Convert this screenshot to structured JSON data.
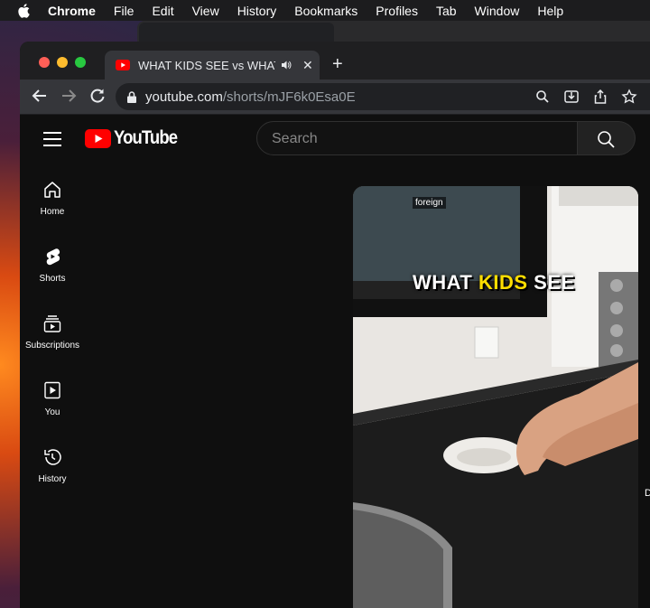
{
  "menubar": {
    "app": "Chrome",
    "items": [
      "File",
      "Edit",
      "View",
      "History",
      "Bookmarks",
      "Profiles",
      "Tab",
      "Window",
      "Help"
    ]
  },
  "browser": {
    "tab_title": "WHAT KIDS SEE vs WHAT PARENTS SEE",
    "url_host": "youtube.com",
    "url_path": "/shorts/mJF6k0Esa0E",
    "traffic_light_colors": [
      "#ff5f57",
      "#febc2e",
      "#28c840"
    ]
  },
  "youtube": {
    "logo_text": "YouTube",
    "brand_color": "#ff0000",
    "search_placeholder": "Search",
    "nav": [
      {
        "label": "Home",
        "icon": "home-icon"
      },
      {
        "label": "Shorts",
        "icon": "shorts-icon"
      },
      {
        "label": "Subscriptions",
        "icon": "subscriptions-icon"
      },
      {
        "label": "You",
        "icon": "you-icon"
      },
      {
        "label": "History",
        "icon": "history-icon"
      }
    ],
    "video": {
      "badge": "foreign",
      "caption_part1": "WHAT ",
      "caption_highlight": "KIDS",
      "caption_part2": " SEE",
      "highlight_color": "#ffde00"
    },
    "edge_letter": "D"
  }
}
